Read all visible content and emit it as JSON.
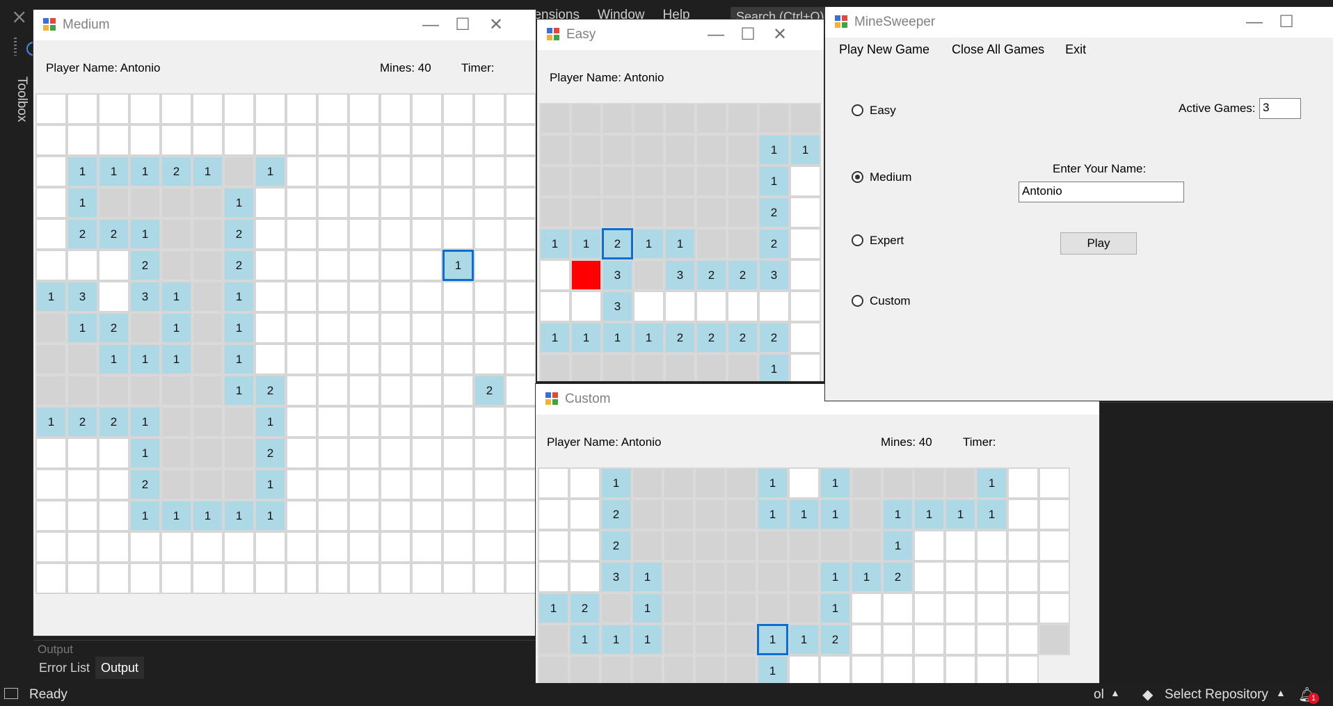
{
  "ide": {
    "menu_items": [
      "Extensions",
      "Window",
      "Help"
    ],
    "search": "Search (Ctrl+Q)",
    "toolbox": "Toolbox",
    "panel_title": "Output",
    "tabs": [
      "Error List",
      "Output"
    ],
    "status": "Ready",
    "select_repo": "Select Repository",
    "notification_count": "1",
    "status_partial": "ol"
  },
  "medium": {
    "title": "Medium",
    "player": "Player Name: Antonio",
    "mines": "Mines: 40",
    "timer": "Timer:",
    "rows": [
      "................",
      "................",
      ".11121 1........",
      ".1gggg1.........",
      ".221gg2.........",
      "...2gg2......*1..",
      "13.31g1.........",
      "g12 1g1.........",
      "gg111g1.........",
      "gggggg12......2.",
      "1221ggg1........",
      "...1ggg2........",
      "...2ggg1........",
      "...11111........",
      "................",
      "................"
    ]
  },
  "easy": {
    "title": "Easy",
    "player": "Player Name: Antonio",
    "rows": [
      "ggggggggg",
      "ggggggg11",
      "ggggggg1.",
      "ggggggg2.",
      "11*211gg2.",
      ".R3 3223.",
      "..3......",
      "11112222.",
      "ggggggg1."
    ]
  },
  "custom": {
    "title": "Custom",
    "player": "Player Name: Antonio",
    "mines": "Mines: 40",
    "timer": "Timer:",
    "rows": [
      "..1gggg1.1gggg1..",
      "..2gggg111g1111..",
      "..2gggggggg1.....",
      "..31ggggg112.....",
      "12 1ggggg1.......",
      "g111ggg*112......",
      "gggggggg1........"
    ]
  },
  "minesweeper": {
    "title": "MineSweeper",
    "menu": [
      "Play New Game",
      "Close All Games",
      "Exit"
    ],
    "options": [
      "Easy",
      "Medium",
      "Expert",
      "Custom"
    ],
    "selected": "Medium",
    "active_games_label": "Active Games:",
    "active_games_value": "3",
    "name_label": "Enter Your Name:",
    "name_value": "Antonio",
    "play_label": "Play"
  },
  "colors": {
    "unrevealed": "#ffffff",
    "revealed_empty": "#d3d3d3",
    "number": "#add8e6",
    "mine": "#ff0000",
    "selected_outline": "#0a6fd2"
  }
}
